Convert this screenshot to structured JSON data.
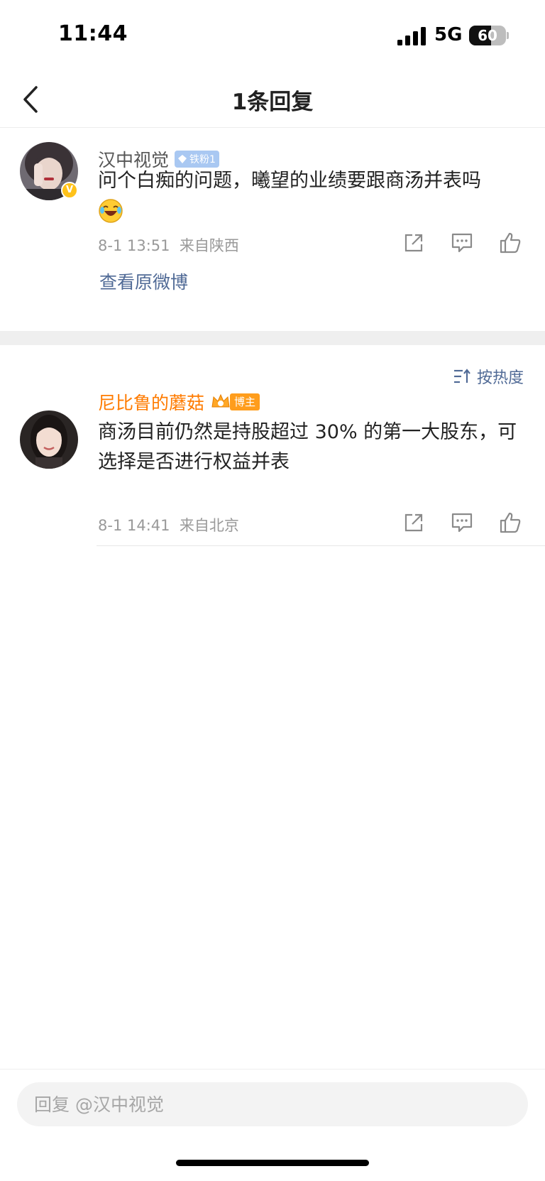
{
  "status_bar": {
    "time": "11:44",
    "network": "5G",
    "battery": "60",
    "battery_level": 0.6
  },
  "nav": {
    "title": "1条回复"
  },
  "main_comment": {
    "username": "汉中视觉",
    "badge": "铁粉1",
    "verified_badge": "V",
    "text": "问个白痴的问题，曦望的业绩要跟商汤并表吗",
    "emoji": "laughing-crying-icon",
    "time": "8-1 13:51",
    "location": "来自陕西",
    "view_original": "查看原微博"
  },
  "sort": {
    "label": "按热度"
  },
  "replies": [
    {
      "username": "尼比鲁的蘑菇",
      "badge": "博主",
      "text": "商汤目前仍然是持股超过 30% 的第一大股东，可选择是否进行权益并表",
      "time": "8-1 14:41",
      "location": "来自北京"
    }
  ],
  "reply_bar": {
    "placeholder": "回复 @汉中视觉"
  },
  "colors": {
    "link": "#506a96",
    "blogger_name": "#ff7b00",
    "fan_badge": "#a9c8f2",
    "blogger_badge": "#ff9d1c",
    "verified": "#ffc21a"
  }
}
